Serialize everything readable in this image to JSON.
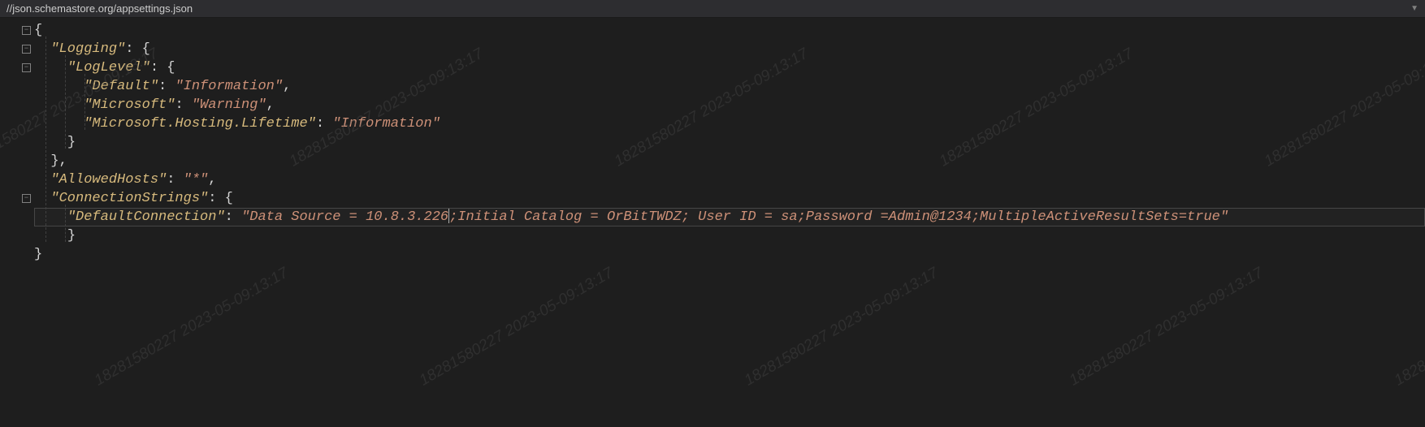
{
  "header": {
    "schema_url": "//json.schemastore.org/appsettings.json"
  },
  "code": {
    "line1_brace": "{",
    "line2_key": "\"Logging\"",
    "line2_colon": ": ",
    "line2_brace": "{",
    "line3_key": "\"LogLevel\"",
    "line3_colon": ": ",
    "line3_brace": "{",
    "line4_key": "\"Default\"",
    "line4_colon": ": ",
    "line4_value": "\"Information\"",
    "line4_comma": ",",
    "line5_key": "\"Microsoft\"",
    "line5_colon": ": ",
    "line5_value": "\"Warning\"",
    "line5_comma": ",",
    "line6_key": "\"Microsoft.Hosting.Lifetime\"",
    "line6_colon": ": ",
    "line6_value": "\"Information\"",
    "line7_brace": "}",
    "line8_brace": "}",
    "line8_comma": ",",
    "line9_key": "\"AllowedHosts\"",
    "line9_colon": ": ",
    "line9_value": "\"*\"",
    "line9_comma": ",",
    "line10_key": "\"ConnectionStrings\"",
    "line10_colon": ": ",
    "line10_brace": "{",
    "line11_key": "\"DefaultConnection\"",
    "line11_colon": ": ",
    "line11_value": "\"Data Source = 10.8.3.226;Initial Catalog = OrBitTWDZ; User ID = sa;Password =Admin@1234;MultipleActiveResultSets=true\"",
    "line12_brace": "}",
    "line13_brace": "}"
  },
  "watermark": {
    "text": "18281580227 2023-05-09:13:17"
  }
}
